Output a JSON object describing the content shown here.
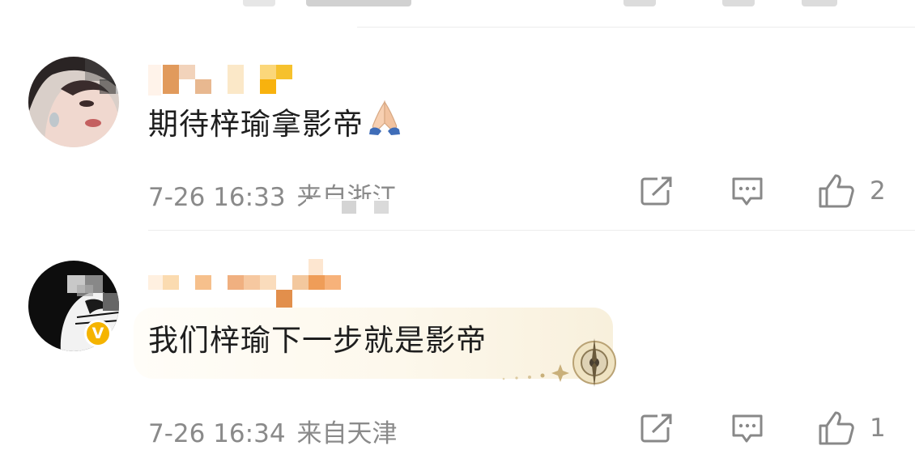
{
  "comments": [
    {
      "text": "期待梓瑜拿影帝",
      "emoji": "🙏",
      "time": "7-26 16:33",
      "location": "来自浙江",
      "like_count": "2"
    },
    {
      "text": "我们梓瑜下一步就是影帝",
      "time": "7-26 16:34",
      "location": "来自天津",
      "like_count": "1",
      "verified_badge": "V"
    }
  ],
  "icons": {
    "share": "share-icon",
    "comment": "comment-icon",
    "like": "thumbs-up-icon"
  },
  "colors": {
    "text": "#1e1e1e",
    "meta": "#8a8a8a",
    "divider": "#ececec",
    "verified": "#f5b400"
  }
}
